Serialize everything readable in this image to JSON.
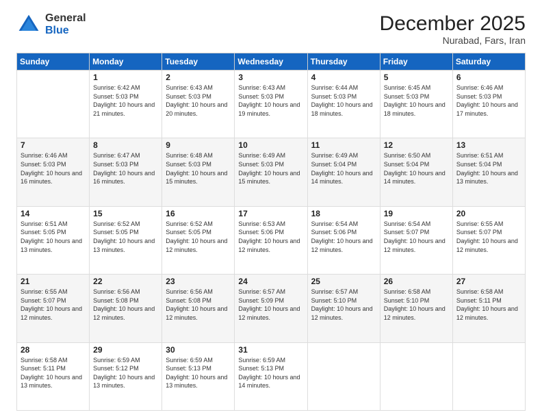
{
  "logo": {
    "general": "General",
    "blue": "Blue"
  },
  "title": "December 2025",
  "subtitle": "Nurabad, Fars, Iran",
  "days": [
    "Sunday",
    "Monday",
    "Tuesday",
    "Wednesday",
    "Thursday",
    "Friday",
    "Saturday"
  ],
  "weeks": [
    [
      {
        "day": "",
        "sunrise": "",
        "sunset": "",
        "daylight": ""
      },
      {
        "day": "1",
        "sunrise": "Sunrise: 6:42 AM",
        "sunset": "Sunset: 5:03 PM",
        "daylight": "Daylight: 10 hours and 21 minutes."
      },
      {
        "day": "2",
        "sunrise": "Sunrise: 6:43 AM",
        "sunset": "Sunset: 5:03 PM",
        "daylight": "Daylight: 10 hours and 20 minutes."
      },
      {
        "day": "3",
        "sunrise": "Sunrise: 6:43 AM",
        "sunset": "Sunset: 5:03 PM",
        "daylight": "Daylight: 10 hours and 19 minutes."
      },
      {
        "day": "4",
        "sunrise": "Sunrise: 6:44 AM",
        "sunset": "Sunset: 5:03 PM",
        "daylight": "Daylight: 10 hours and 18 minutes."
      },
      {
        "day": "5",
        "sunrise": "Sunrise: 6:45 AM",
        "sunset": "Sunset: 5:03 PM",
        "daylight": "Daylight: 10 hours and 18 minutes."
      },
      {
        "day": "6",
        "sunrise": "Sunrise: 6:46 AM",
        "sunset": "Sunset: 5:03 PM",
        "daylight": "Daylight: 10 hours and 17 minutes."
      }
    ],
    [
      {
        "day": "7",
        "sunrise": "Sunrise: 6:46 AM",
        "sunset": "Sunset: 5:03 PM",
        "daylight": "Daylight: 10 hours and 16 minutes."
      },
      {
        "day": "8",
        "sunrise": "Sunrise: 6:47 AM",
        "sunset": "Sunset: 5:03 PM",
        "daylight": "Daylight: 10 hours and 16 minutes."
      },
      {
        "day": "9",
        "sunrise": "Sunrise: 6:48 AM",
        "sunset": "Sunset: 5:03 PM",
        "daylight": "Daylight: 10 hours and 15 minutes."
      },
      {
        "day": "10",
        "sunrise": "Sunrise: 6:49 AM",
        "sunset": "Sunset: 5:03 PM",
        "daylight": "Daylight: 10 hours and 15 minutes."
      },
      {
        "day": "11",
        "sunrise": "Sunrise: 6:49 AM",
        "sunset": "Sunset: 5:04 PM",
        "daylight": "Daylight: 10 hours and 14 minutes."
      },
      {
        "day": "12",
        "sunrise": "Sunrise: 6:50 AM",
        "sunset": "Sunset: 5:04 PM",
        "daylight": "Daylight: 10 hours and 14 minutes."
      },
      {
        "day": "13",
        "sunrise": "Sunrise: 6:51 AM",
        "sunset": "Sunset: 5:04 PM",
        "daylight": "Daylight: 10 hours and 13 minutes."
      }
    ],
    [
      {
        "day": "14",
        "sunrise": "Sunrise: 6:51 AM",
        "sunset": "Sunset: 5:05 PM",
        "daylight": "Daylight: 10 hours and 13 minutes."
      },
      {
        "day": "15",
        "sunrise": "Sunrise: 6:52 AM",
        "sunset": "Sunset: 5:05 PM",
        "daylight": "Daylight: 10 hours and 13 minutes."
      },
      {
        "day": "16",
        "sunrise": "Sunrise: 6:52 AM",
        "sunset": "Sunset: 5:05 PM",
        "daylight": "Daylight: 10 hours and 12 minutes."
      },
      {
        "day": "17",
        "sunrise": "Sunrise: 6:53 AM",
        "sunset": "Sunset: 5:06 PM",
        "daylight": "Daylight: 10 hours and 12 minutes."
      },
      {
        "day": "18",
        "sunrise": "Sunrise: 6:54 AM",
        "sunset": "Sunset: 5:06 PM",
        "daylight": "Daylight: 10 hours and 12 minutes."
      },
      {
        "day": "19",
        "sunrise": "Sunrise: 6:54 AM",
        "sunset": "Sunset: 5:07 PM",
        "daylight": "Daylight: 10 hours and 12 minutes."
      },
      {
        "day": "20",
        "sunrise": "Sunrise: 6:55 AM",
        "sunset": "Sunset: 5:07 PM",
        "daylight": "Daylight: 10 hours and 12 minutes."
      }
    ],
    [
      {
        "day": "21",
        "sunrise": "Sunrise: 6:55 AM",
        "sunset": "Sunset: 5:07 PM",
        "daylight": "Daylight: 10 hours and 12 minutes."
      },
      {
        "day": "22",
        "sunrise": "Sunrise: 6:56 AM",
        "sunset": "Sunset: 5:08 PM",
        "daylight": "Daylight: 10 hours and 12 minutes."
      },
      {
        "day": "23",
        "sunrise": "Sunrise: 6:56 AM",
        "sunset": "Sunset: 5:08 PM",
        "daylight": "Daylight: 10 hours and 12 minutes."
      },
      {
        "day": "24",
        "sunrise": "Sunrise: 6:57 AM",
        "sunset": "Sunset: 5:09 PM",
        "daylight": "Daylight: 10 hours and 12 minutes."
      },
      {
        "day": "25",
        "sunrise": "Sunrise: 6:57 AM",
        "sunset": "Sunset: 5:10 PM",
        "daylight": "Daylight: 10 hours and 12 minutes."
      },
      {
        "day": "26",
        "sunrise": "Sunrise: 6:58 AM",
        "sunset": "Sunset: 5:10 PM",
        "daylight": "Daylight: 10 hours and 12 minutes."
      },
      {
        "day": "27",
        "sunrise": "Sunrise: 6:58 AM",
        "sunset": "Sunset: 5:11 PM",
        "daylight": "Daylight: 10 hours and 12 minutes."
      }
    ],
    [
      {
        "day": "28",
        "sunrise": "Sunrise: 6:58 AM",
        "sunset": "Sunset: 5:11 PM",
        "daylight": "Daylight: 10 hours and 13 minutes."
      },
      {
        "day": "29",
        "sunrise": "Sunrise: 6:59 AM",
        "sunset": "Sunset: 5:12 PM",
        "daylight": "Daylight: 10 hours and 13 minutes."
      },
      {
        "day": "30",
        "sunrise": "Sunrise: 6:59 AM",
        "sunset": "Sunset: 5:13 PM",
        "daylight": "Daylight: 10 hours and 13 minutes."
      },
      {
        "day": "31",
        "sunrise": "Sunrise: 6:59 AM",
        "sunset": "Sunset: 5:13 PM",
        "daylight": "Daylight: 10 hours and 14 minutes."
      },
      {
        "day": "",
        "sunrise": "",
        "sunset": "",
        "daylight": ""
      },
      {
        "day": "",
        "sunrise": "",
        "sunset": "",
        "daylight": ""
      },
      {
        "day": "",
        "sunrise": "",
        "sunset": "",
        "daylight": ""
      }
    ]
  ]
}
